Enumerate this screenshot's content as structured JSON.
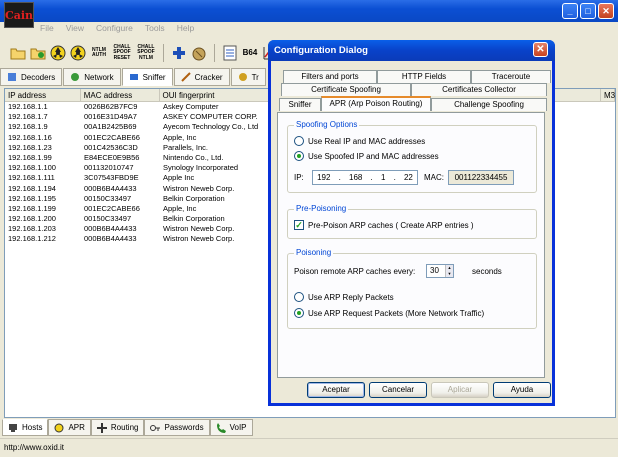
{
  "app": {
    "logo_text": "Cain",
    "menu": [
      "File",
      "View",
      "Configure",
      "Tools",
      "Help"
    ],
    "toolbar": [
      "folder-open-icon",
      "folder-add-icon",
      "radiation-icon",
      "radiation-2-icon",
      "NTLM AUTH",
      "CHALL SPOOF RESET",
      "CHALL SPOOF NTLM",
      "plus-icon",
      "cracker-icon",
      "list-icon",
      "B64",
      "chart-icon",
      "info-icon"
    ],
    "tabs": [
      "Decoders",
      "Network",
      "Sniffer",
      "Cracker",
      "Tr"
    ],
    "active_tab": "Sniffer"
  },
  "table": {
    "columns": [
      "IP address",
      "MAC address",
      "OUI fingerprint"
    ],
    "extra_column": "M3",
    "rows": [
      [
        "192.168.1.1",
        "0026B62B7FC9",
        "Askey Computer"
      ],
      [
        "192.168.1.7",
        "0016E31D49A7",
        "ASKEY COMPUTER CORP."
      ],
      [
        "192.168.1.9",
        "00A1B2425B69",
        "Ayecom Technology Co., Ltd"
      ],
      [
        "192.168.1.16",
        "001EC2CABE66",
        "Apple, Inc"
      ],
      [
        "192.168.1.23",
        "001C42536C3D",
        "Parallels, Inc."
      ],
      [
        "192.168.1.99",
        "E84ECE0E9B56",
        "Nintendo Co., Ltd."
      ],
      [
        "192.168.1.100",
        "001132010747",
        "Synology Incorporated"
      ],
      [
        "192.168.1.111",
        "3C07543FBD9E",
        "Apple Inc"
      ],
      [
        "192.168.1.194",
        "000B6B4A4433",
        "Wistron Neweb Corp."
      ],
      [
        "192.168.1.195",
        "00150C33497",
        "Belkin Corporation"
      ],
      [
        "192.168.1.199",
        "001EC2CABE66",
        "Apple, Inc"
      ],
      [
        "192.168.1.200",
        "00150C33497",
        "Belkin Corporation"
      ],
      [
        "192.168.1.203",
        "000B6B4A4433",
        "Wistron Neweb Corp."
      ],
      [
        "192.168.1.212",
        "000B6B4A4433",
        "Wistron Neweb Corp."
      ]
    ]
  },
  "bottom_tabs": [
    "Hosts",
    "APR",
    "Routing",
    "Passwords",
    "VoIP"
  ],
  "status": "http://www.oxid.it",
  "dialog": {
    "title": "Configuration Dialog",
    "tabs_row1": [
      "Filters and ports",
      "HTTP Fields",
      "Traceroute"
    ],
    "tabs_row2": [
      "Certificate Spoofing",
      "Certificates Collector"
    ],
    "tabs_row3": [
      "Sniffer",
      "APR (Arp Poison Routing)",
      "Challenge Spoofing"
    ],
    "spoofing": {
      "label": "Spoofing Options",
      "opt_real": "Use Real IP and MAC addresses",
      "opt_spoofed": "Use Spoofed IP and MAC addresses",
      "ip_label": "IP:",
      "ip": [
        "192",
        "168",
        "1",
        "22"
      ],
      "mac_label": "MAC:",
      "mac": "001122334455"
    },
    "prepoison": {
      "label": "Pre-Poisoning",
      "check": "Pre-Poison ARP caches ( Create ARP entries )"
    },
    "poisoning": {
      "label": "Poisoning",
      "every_label": "Poison remote ARP caches every:",
      "every_value": "30",
      "unit": "seconds",
      "opt_reply": "Use ARP Reply Packets",
      "opt_request": "Use ARP Request Packets (More Network Traffic)"
    },
    "buttons": {
      "ok": "Aceptar",
      "cancel": "Cancelar",
      "apply": "Aplicar",
      "help": "Ayuda"
    }
  }
}
